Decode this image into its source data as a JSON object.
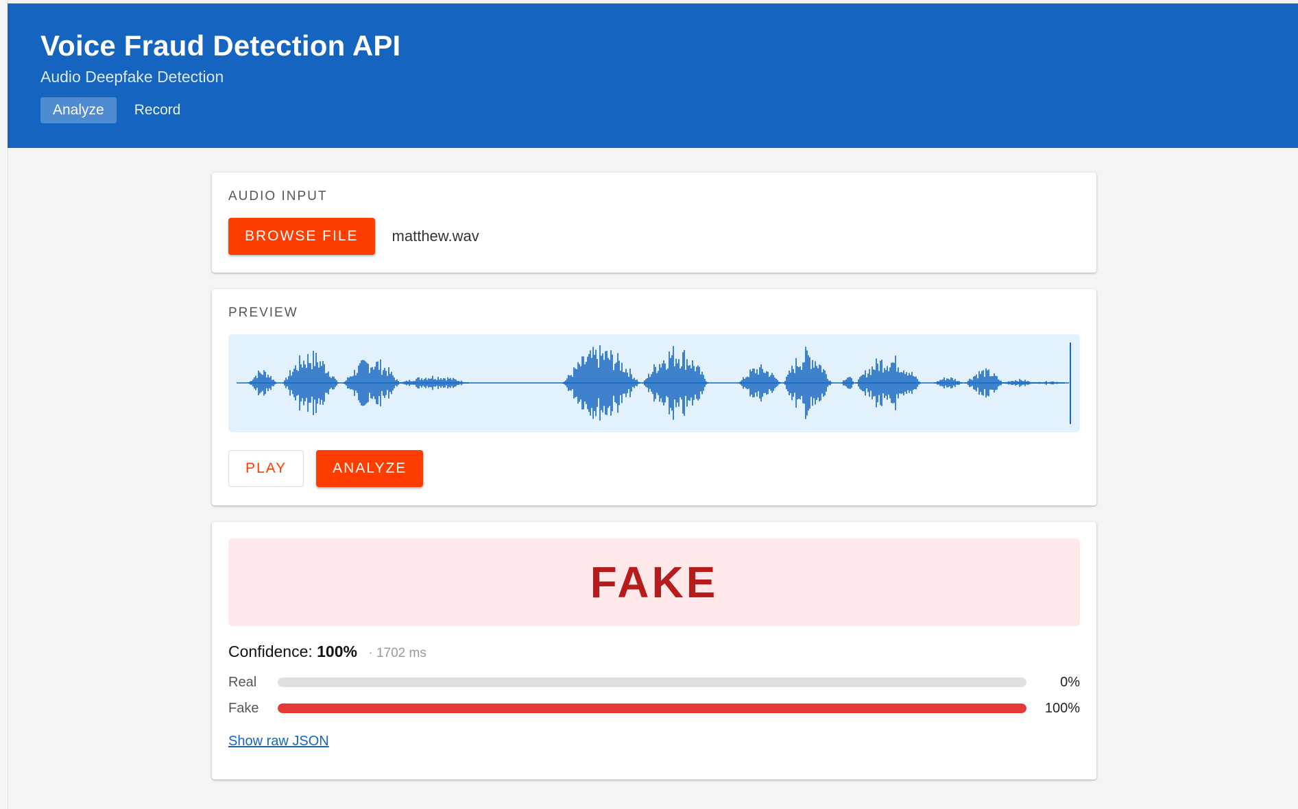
{
  "header": {
    "title": "Voice Fraud Detection API",
    "subtitle": "Audio Deepfake Detection",
    "tabs": [
      {
        "label": "Analyze",
        "active": true
      },
      {
        "label": "Record",
        "active": false
      }
    ],
    "bg_color": "#1565c0"
  },
  "audio_input": {
    "section_label": "AUDIO INPUT",
    "browse_label": "BROWSE FILE",
    "file_name": "matthew.wav"
  },
  "preview": {
    "section_label": "PREVIEW",
    "play_label": "PLAY",
    "analyze_label": "ANALYZE",
    "waveform_color": "#1565c0",
    "waveform_bg": "#e3f1fc"
  },
  "result": {
    "verdict": "FAKE",
    "confidence_label": "Confidence:",
    "confidence_value": "100%",
    "latency": "· 1702 ms",
    "probabilities": [
      {
        "label": "Real",
        "value": 0,
        "display": "0%",
        "color": "#e0e0e0"
      },
      {
        "label": "Fake",
        "value": 1,
        "display": "100%",
        "color": "#e53935"
      }
    ],
    "raw_json_link": "Show raw JSON"
  },
  "accent_color": "#ff3d00"
}
